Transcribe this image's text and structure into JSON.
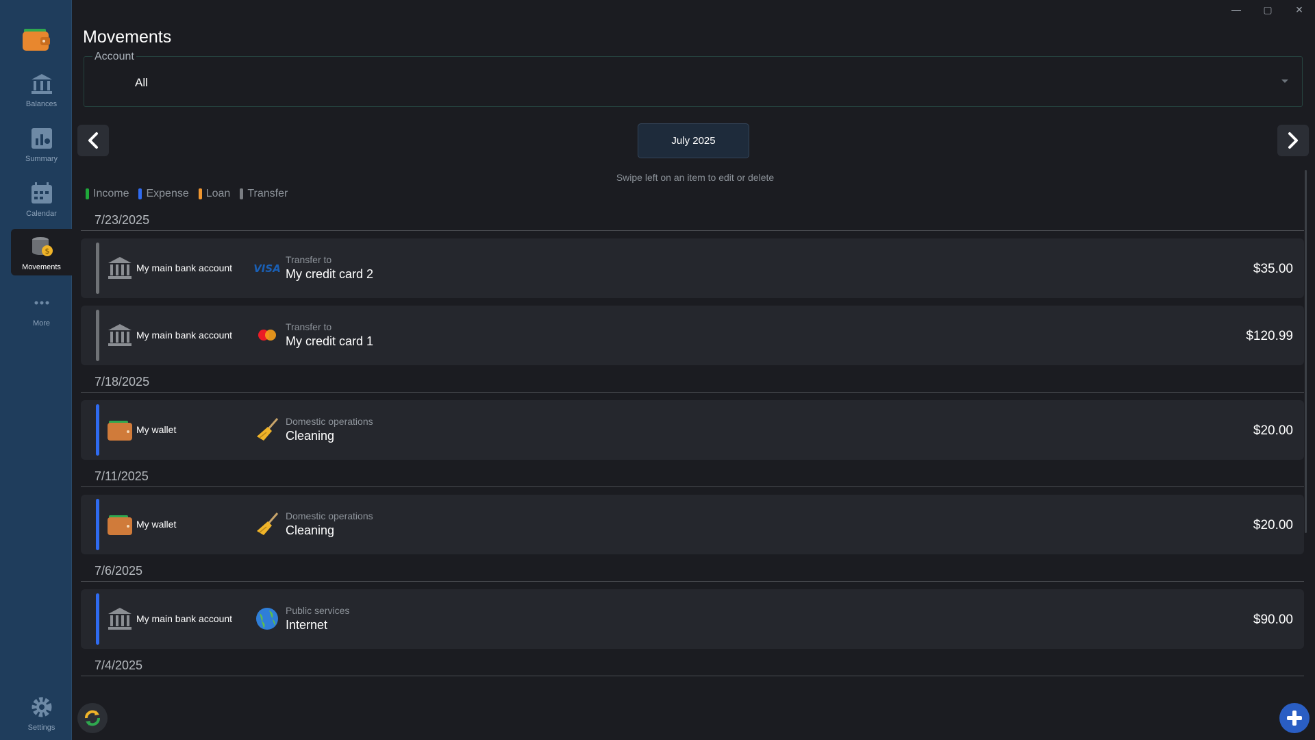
{
  "window": {
    "minimize_glyph": "—",
    "maximize_glyph": "▢",
    "close_glyph": "✕"
  },
  "sidebar": {
    "items": [
      {
        "label": "Balances",
        "icon": "bank-icon"
      },
      {
        "label": "Summary",
        "icon": "chart-icon"
      },
      {
        "label": "Calendar",
        "icon": "calendar-icon"
      },
      {
        "label": "Movements",
        "icon": "coins-icon",
        "active": true
      },
      {
        "label": "More",
        "icon": "more-icon"
      }
    ],
    "settings_label": "Settings"
  },
  "page": {
    "title": "Movements"
  },
  "account_filter": {
    "label": "Account",
    "value": "All"
  },
  "period": {
    "month_label": "July 2025",
    "hint": "Swipe left on an item to edit or delete"
  },
  "legend": [
    {
      "label": "Income",
      "color": "#1fa83a"
    },
    {
      "label": "Expense",
      "color": "#2f6bf0"
    },
    {
      "label": "Loan",
      "color": "#f0962f"
    },
    {
      "label": "Transfer",
      "color": "#7a7d82"
    }
  ],
  "colors": {
    "transfer": "#6f7276",
    "expense": "#2f6bf0",
    "accent": "#2a5ec4"
  },
  "groups": [
    {
      "date": "7/23/2025",
      "items": [
        {
          "account": "My main bank account",
          "account_icon": "bank-building-icon",
          "category_icon": "visa-card-icon",
          "subtitle": "Transfer to",
          "title": "My credit card 2",
          "amount": "$35.00",
          "type": "transfer"
        },
        {
          "account": "My main bank account",
          "account_icon": "bank-building-icon",
          "category_icon": "mastercard-icon",
          "subtitle": "Transfer to",
          "title": "My credit card 1",
          "amount": "$120.99",
          "type": "transfer"
        }
      ]
    },
    {
      "date": "7/18/2025",
      "items": [
        {
          "account": "My wallet",
          "account_icon": "wallet-icon",
          "category_icon": "broom-icon",
          "subtitle": "Domestic operations",
          "title": "Cleaning",
          "amount": "$20.00",
          "type": "expense"
        }
      ]
    },
    {
      "date": "7/11/2025",
      "items": [
        {
          "account": "My wallet",
          "account_icon": "wallet-icon",
          "category_icon": "broom-icon",
          "subtitle": "Domestic operations",
          "title": "Cleaning",
          "amount": "$20.00",
          "type": "expense"
        }
      ]
    },
    {
      "date": "7/6/2025",
      "items": [
        {
          "account": "My main bank account",
          "account_icon": "bank-building-icon",
          "category_icon": "globe-icon",
          "subtitle": "Public services",
          "title": "Internet",
          "amount": "$90.00",
          "type": "expense"
        }
      ]
    },
    {
      "date": "7/4/2025",
      "items": []
    }
  ]
}
